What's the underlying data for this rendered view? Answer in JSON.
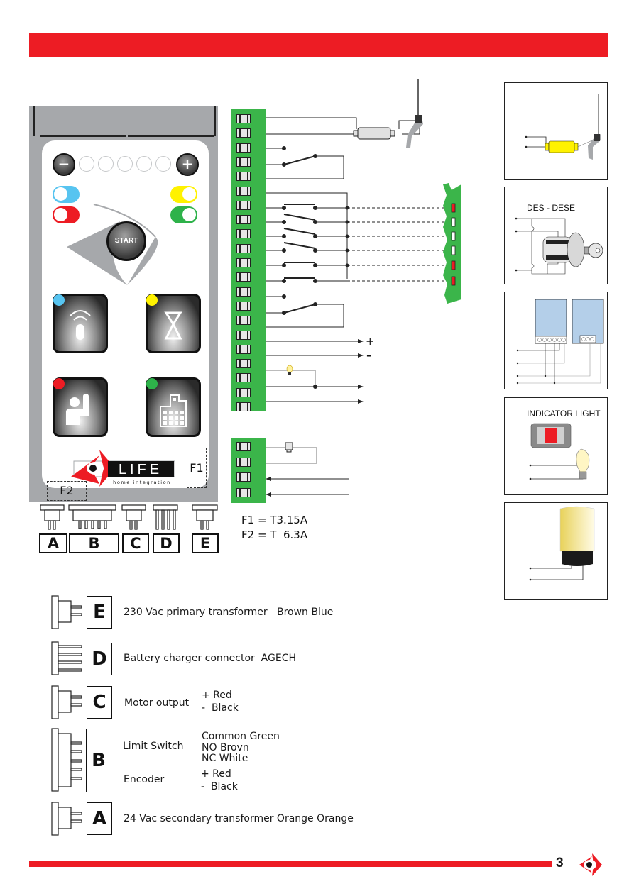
{
  "page": {
    "number": "3",
    "accent_color": "#ed1c24",
    "terminal_color": "#3bb54a"
  },
  "panel": {
    "start_label": "START",
    "minus_label": "−",
    "plus_label": "+",
    "led_pills": [
      {
        "name": "blue",
        "color": "#57c4f0"
      },
      {
        "name": "red",
        "color": "#ed1c24"
      },
      {
        "name": "yellow",
        "color": "#fff200"
      },
      {
        "name": "green",
        "color": "#2eb24a"
      }
    ],
    "tiles": [
      {
        "icon": "remote-control-icon",
        "led": "#57c4f0"
      },
      {
        "icon": "hourglass-icon",
        "led": "#fff200"
      },
      {
        "icon": "person-hand-raised-icon",
        "led": "#ed1c24"
      },
      {
        "icon": "building-icon",
        "led": "#2eb24a"
      }
    ],
    "brand": {
      "name": "LIFE",
      "tagline": "home integration"
    },
    "fuse_f1": "F1",
    "fuse_f2": "F2",
    "connectors": [
      "A",
      "B",
      "C",
      "D",
      "E"
    ]
  },
  "wiring": {
    "plus_label": "+",
    "minus_label": "-",
    "fuse_ratings": [
      "F1 = T3.15A",
      "F2 = T  6.3A"
    ]
  },
  "accessories": [
    {
      "name": "antenna-receiver",
      "title": ""
    },
    {
      "name": "key-selector",
      "title": "DES - DESE"
    },
    {
      "name": "photocells",
      "title": ""
    },
    {
      "name": "indicator-light",
      "title": "INDICATOR LIGHT"
    },
    {
      "name": "flashing-lamp",
      "title": ""
    }
  ],
  "legend": [
    {
      "letter": "E",
      "label": "230 Vac primary transformer   Brown Blue"
    },
    {
      "letter": "D",
      "label": "Battery charger connector  AGECH"
    },
    {
      "letter": "C",
      "label": "Motor output",
      "wires": [
        "+ Red",
        "-  Black"
      ]
    },
    {
      "letter": "B",
      "label": "Limit Switch",
      "wires": [
        "Common Green",
        "NO Brovn",
        "NC White"
      ],
      "label2": "Encoder",
      "wires2": [
        "+ Red",
        "-  Black"
      ]
    },
    {
      "letter": "A",
      "label": "24 Vac secondary transformer  Orange Orange"
    }
  ]
}
